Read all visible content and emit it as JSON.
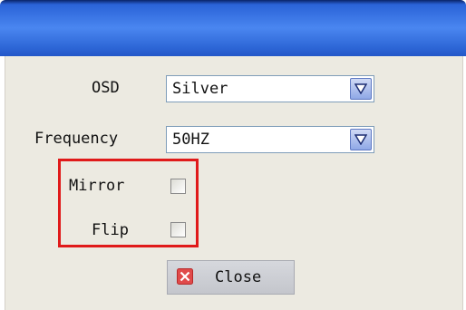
{
  "form": {
    "osd": {
      "label": "OSD",
      "value": "Silver"
    },
    "frequency": {
      "label": "Frequency",
      "value": "50HZ"
    },
    "mirror": {
      "label": "Mirror",
      "checked": false
    },
    "flip": {
      "label": "Flip",
      "checked": false
    },
    "close_label": "Close"
  },
  "colors": {
    "titlebar": "#2a63d8",
    "window_bg": "#eceae1",
    "highlight": "#e01a1a",
    "close_icon": "#e04a4a"
  },
  "icons": {
    "dropdown": "chevron-down-icon",
    "close": "close-icon"
  }
}
